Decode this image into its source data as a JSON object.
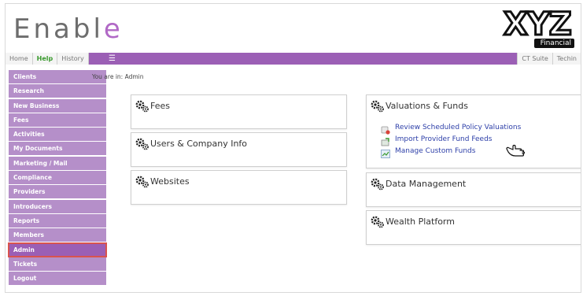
{
  "header": {
    "logo_main": "Enabl",
    "logo_accent": "e",
    "brand_logo": "XYZ",
    "brand_sub": "Financial"
  },
  "nav": {
    "tabs": [
      {
        "label": "Home",
        "active": false
      },
      {
        "label": "Help",
        "active": true
      },
      {
        "label": "History",
        "active": false
      }
    ],
    "menu_icon": "hamburger-icon",
    "right_tabs": [
      "CT Suite",
      "Techin"
    ]
  },
  "sidebar": {
    "items": [
      {
        "label": "Clients",
        "active": false
      },
      {
        "label": "Research",
        "active": false
      },
      {
        "label": "New Business",
        "active": false
      },
      {
        "label": "Fees",
        "active": false
      },
      {
        "label": "Activities",
        "active": false
      },
      {
        "label": "My Documents",
        "active": false
      },
      {
        "label": "Marketing / Mail",
        "active": false
      },
      {
        "label": "Compliance",
        "active": false
      },
      {
        "label": "Providers",
        "active": false
      },
      {
        "label": "Introducers",
        "active": false
      },
      {
        "label": "Reports",
        "active": false
      },
      {
        "label": "Members",
        "active": false
      },
      {
        "label": "Admin",
        "active": true
      },
      {
        "label": "Tickets",
        "active": false
      },
      {
        "label": "Logout",
        "active": false
      }
    ]
  },
  "breadcrumb": "You are in: Admin",
  "panels": {
    "fees": "Fees",
    "users": "Users & Company Info",
    "websites": "Websites",
    "valuations": {
      "title": "Valuations & Funds",
      "links": [
        {
          "label": "Review Scheduled Policy Valuations",
          "icon": "schedule-icon"
        },
        {
          "label": "Import Provider Fund Feeds",
          "icon": "import-icon"
        },
        {
          "label": "Manage Custom Funds",
          "icon": "chart-icon"
        }
      ]
    },
    "data_management": "Data Management",
    "wealth_platform": "Wealth Platform"
  },
  "colors": {
    "brand_purple": "#9b5fb5",
    "sidebar_purple": "#b58fc9",
    "link_blue": "#2d3fa8",
    "active_outline": "#d9534f",
    "help_green": "#3a9a2e"
  }
}
